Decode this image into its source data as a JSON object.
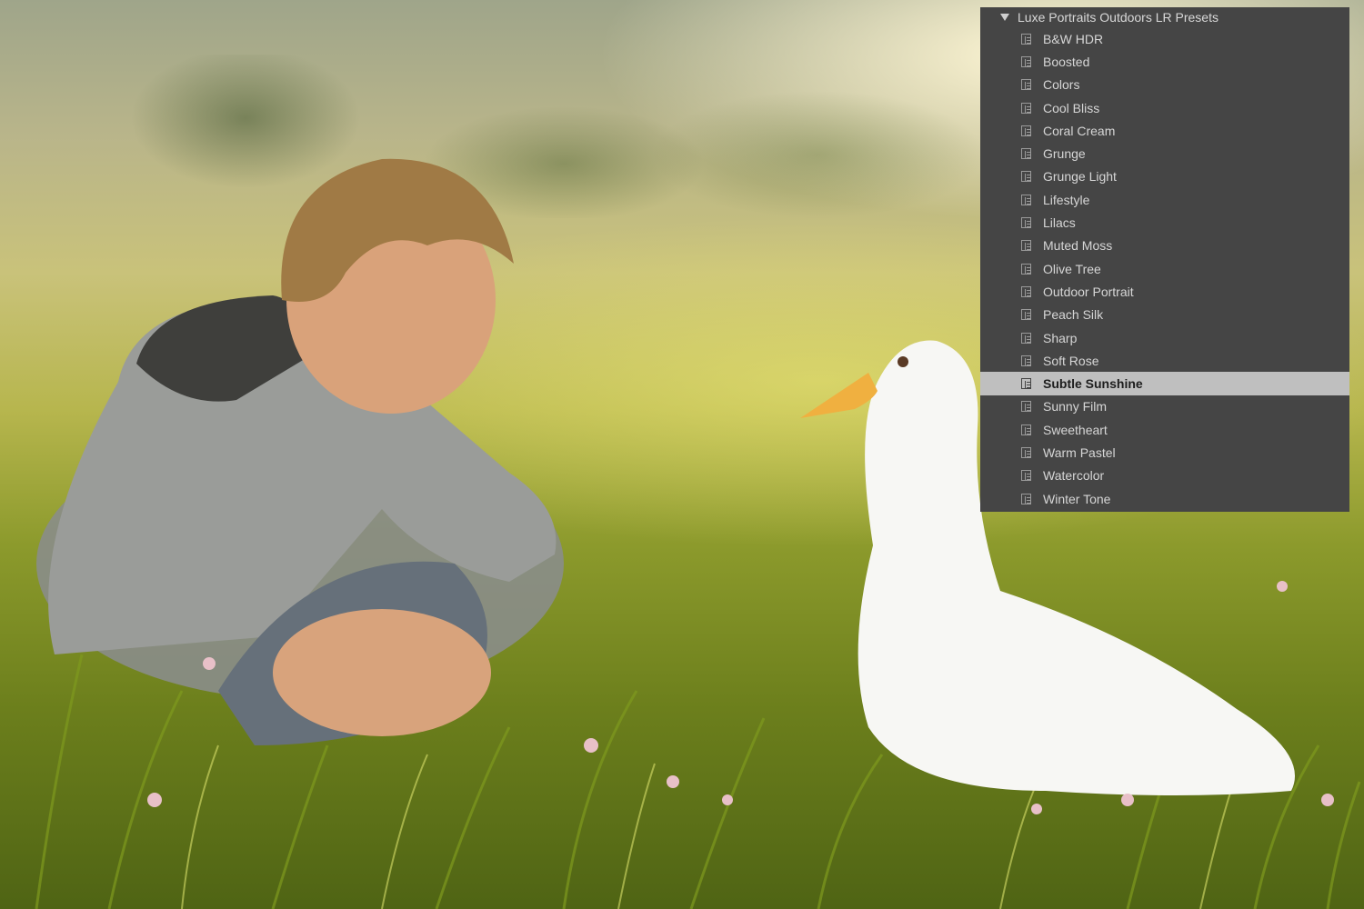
{
  "panel": {
    "folder_title": "Luxe Portraits Outdoors LR Presets",
    "folder_icon": "disclosure-triangle-down",
    "item_icon": "preset-icon",
    "selected_index": 15,
    "colors": {
      "panel_bg": "#454545",
      "text": "#d6d6d6",
      "selected_bg": "#bfbfbf",
      "selected_text": "#1d1d1d"
    },
    "presets": [
      {
        "label": "B&W HDR"
      },
      {
        "label": "Boosted"
      },
      {
        "label": "Colors"
      },
      {
        "label": "Cool Bliss"
      },
      {
        "label": "Coral Cream"
      },
      {
        "label": "Grunge"
      },
      {
        "label": "Grunge Light"
      },
      {
        "label": "Lifestyle"
      },
      {
        "label": "Lilacs"
      },
      {
        "label": "Muted Moss"
      },
      {
        "label": "Olive Tree"
      },
      {
        "label": "Outdoor Portrait"
      },
      {
        "label": "Peach Silk"
      },
      {
        "label": "Sharp"
      },
      {
        "label": "Soft Rose"
      },
      {
        "label": "Subtle Sunshine"
      },
      {
        "label": "Sunny Film"
      },
      {
        "label": "Sweetheart"
      },
      {
        "label": "Warm Pastel"
      },
      {
        "label": "Watercolor"
      },
      {
        "label": "Winter Tone"
      }
    ]
  }
}
